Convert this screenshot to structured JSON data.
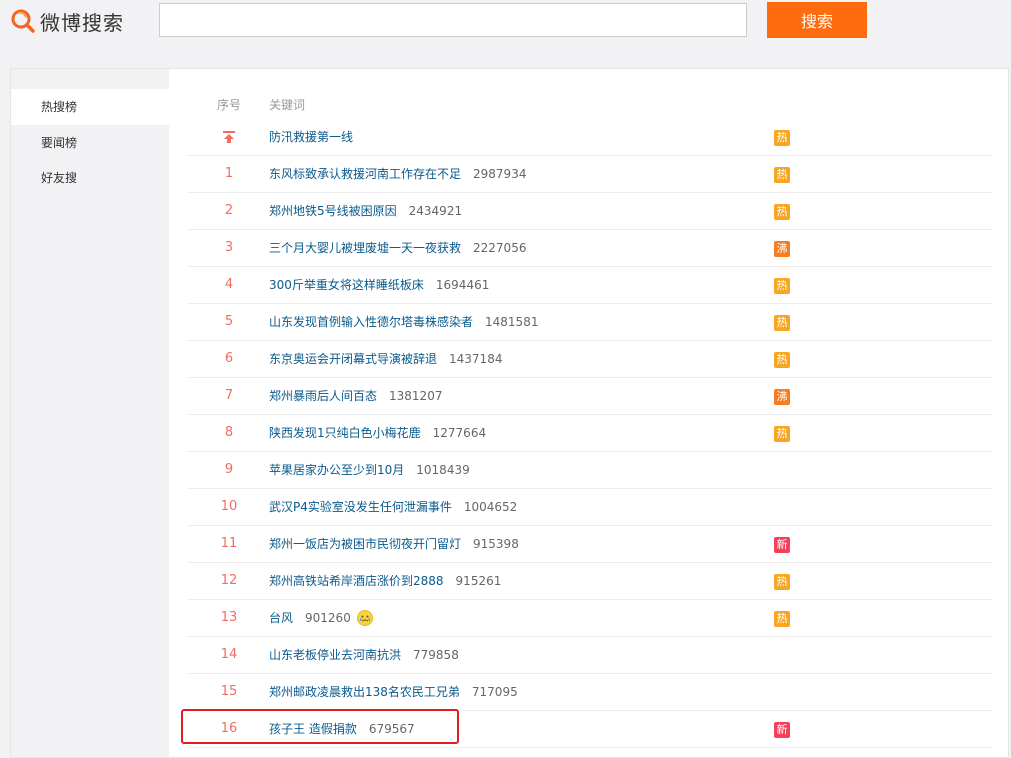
{
  "header": {
    "logo_text": "微博搜索",
    "search_placeholder": "",
    "search_button": "搜索"
  },
  "sidebar": {
    "items": [
      {
        "label": "热搜榜",
        "active": true
      },
      {
        "label": "要闻榜",
        "active": false
      },
      {
        "label": "好友搜",
        "active": false
      }
    ]
  },
  "table": {
    "headers": {
      "rank": "序号",
      "keyword": "关键词"
    },
    "rows": [
      {
        "rank": "",
        "pinned": true,
        "keyword": "防汛救援第一线",
        "count": "",
        "badge": "热",
        "badge_color": "#f7a623"
      },
      {
        "rank": "1",
        "keyword": "东风标致承认救援河南工作存在不足",
        "count": "2987934",
        "badge": "热",
        "badge_color": "#f7a623"
      },
      {
        "rank": "2",
        "keyword": "郑州地铁5号线被困原因",
        "count": "2434921",
        "badge": "热",
        "badge_color": "#f7a623"
      },
      {
        "rank": "3",
        "keyword": "三个月大婴儿被埋废墟一天一夜获救",
        "count": "2227056",
        "badge": "沸",
        "badge_color": "#f57c1f"
      },
      {
        "rank": "4",
        "keyword": "300斤举重女将这样睡纸板床",
        "count": "1694461",
        "badge": "热",
        "badge_color": "#f7a623"
      },
      {
        "rank": "5",
        "keyword": "山东发现首例输入性德尔塔毒株感染者",
        "count": "1481581",
        "badge": "热",
        "badge_color": "#f7a623"
      },
      {
        "rank": "6",
        "keyword": "东京奥运会开闭幕式导演被辞退",
        "count": "1437184",
        "badge": "热",
        "badge_color": "#f7a623"
      },
      {
        "rank": "7",
        "keyword": "郑州暴雨后人间百态",
        "count": "1381207",
        "badge": "沸",
        "badge_color": "#f57c1f"
      },
      {
        "rank": "8",
        "keyword": "陕西发现1只纯白色小梅花鹿",
        "count": "1277664",
        "badge": "热",
        "badge_color": "#f7a623"
      },
      {
        "rank": "9",
        "keyword": "苹果居家办公至少到10月",
        "count": "1018439",
        "badge": "",
        "badge_color": ""
      },
      {
        "rank": "10",
        "keyword": "武汉P4实验室没发生任何泄漏事件",
        "count": "1004652",
        "badge": "",
        "badge_color": ""
      },
      {
        "rank": "11",
        "keyword": "郑州一饭店为被困市民彻夜开门留灯",
        "count": "915398",
        "badge": "新",
        "badge_color": "#f2405d"
      },
      {
        "rank": "12",
        "keyword": "郑州高铁站希岸酒店涨价到2888",
        "count": "915261",
        "badge": "热",
        "badge_color": "#f7a623"
      },
      {
        "rank": "13",
        "keyword": "台风",
        "count": "901260",
        "emoji": true,
        "badge": "热",
        "badge_color": "#f7a623"
      },
      {
        "rank": "14",
        "keyword": "山东老板停业去河南抗洪",
        "count": "779858",
        "badge": "",
        "badge_color": ""
      },
      {
        "rank": "15",
        "keyword": "郑州邮政凌晨救出138名农民工兄弟",
        "count": "717095",
        "badge": "",
        "badge_color": ""
      },
      {
        "rank": "16",
        "keyword": "孩子王 造假捐款",
        "count": "679567",
        "badge": "新",
        "badge_color": "#f2405d",
        "highlighted": true
      }
    ]
  },
  "colors": {
    "accent": "#ff6b0f",
    "rank": "#f26d5f",
    "link": "#0a5a8c",
    "highlight_box": "#e02020"
  }
}
